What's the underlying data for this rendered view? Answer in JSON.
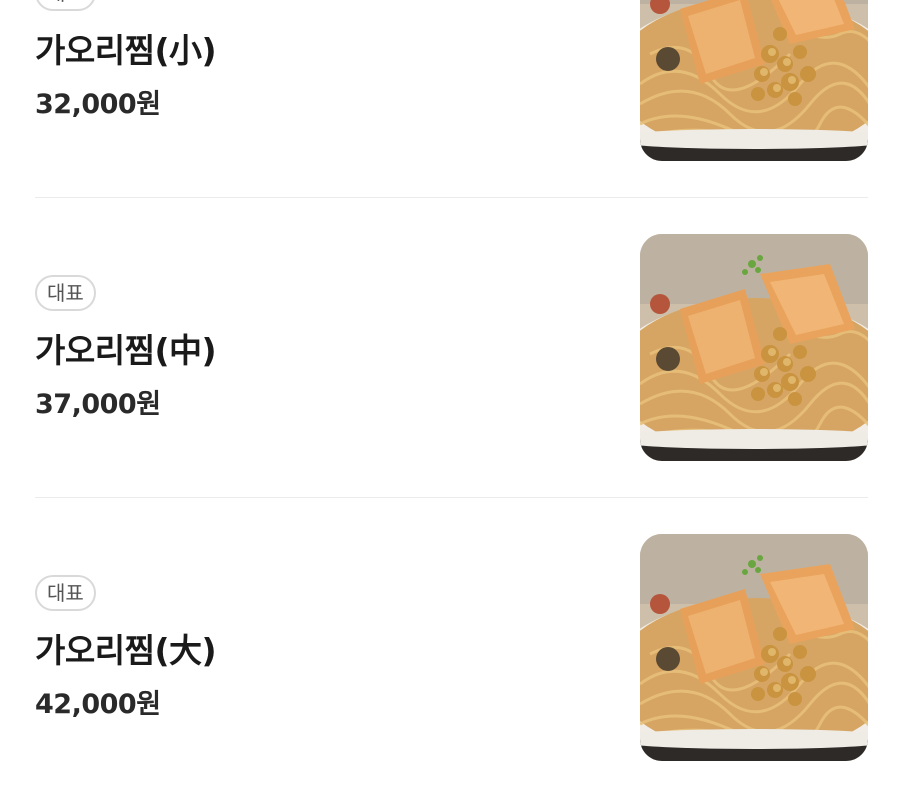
{
  "menu": {
    "items": [
      {
        "badge": "대표",
        "name": "가오리찜(小)",
        "price": "32,000원",
        "image": "braised-stingray-dish-photo"
      },
      {
        "badge": "대표",
        "name": "가오리찜(中)",
        "price": "37,000원",
        "image": "braised-stingray-dish-photo"
      },
      {
        "badge": "대표",
        "name": "가오리찜(大)",
        "price": "42,000원",
        "image": "braised-stingray-dish-photo"
      }
    ]
  },
  "colors": {
    "text_primary": "#1a1a1a",
    "badge_border": "#d9d9d9",
    "divider": "#ebebeb"
  }
}
